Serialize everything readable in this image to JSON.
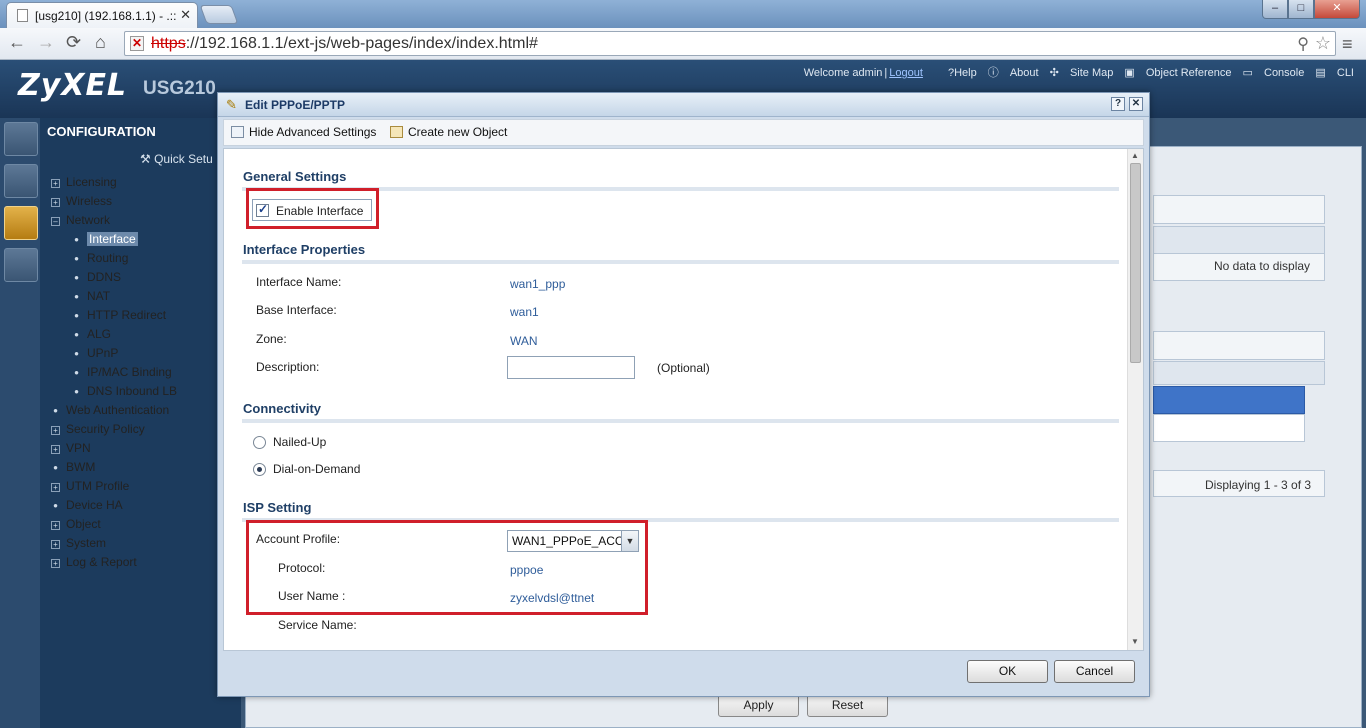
{
  "browser": {
    "tab_title": "[usg210] (192.168.1.1) - .::",
    "tab_close": "✕",
    "url_scheme": "https",
    "url_rest": "://192.168.1.1/ext-js/web-pages/index/index.html#",
    "window_controls": {
      "minimize": "–",
      "maximize": "□",
      "close": "✕"
    },
    "nav": {
      "back": "←",
      "forward": "→",
      "reload": "⟳",
      "home": "⌂"
    },
    "icons": {
      "zoom": "magnifier-icon",
      "star": "bookmark-star-icon",
      "menu": "wrench-menu-icon"
    }
  },
  "app": {
    "logo": "ZyXEL",
    "model": "USG210",
    "toplinks": {
      "welcome": "Welcome admin",
      "separator": "|",
      "logout": "Logout",
      "help": "?Help",
      "about": "About",
      "sitemap": "Site Map",
      "objref": "Object Reference",
      "console": "Console",
      "cli": "CLI"
    }
  },
  "sidebar": {
    "heading": "CONFIGURATION",
    "quick_setup": "Quick Setu",
    "items": [
      {
        "marker": "+",
        "label": "Licensing"
      },
      {
        "marker": "+",
        "label": "Wireless"
      },
      {
        "marker": "–",
        "label": "Network"
      },
      {
        "marker": "•",
        "label": "Interface"
      },
      {
        "marker": "•",
        "label": "Routing"
      },
      {
        "marker": "•",
        "label": "DDNS"
      },
      {
        "marker": "•",
        "label": "NAT"
      },
      {
        "marker": "•",
        "label": "HTTP Redirect"
      },
      {
        "marker": "•",
        "label": "ALG"
      },
      {
        "marker": "•",
        "label": "UPnP"
      },
      {
        "marker": "•",
        "label": "IP/MAC Binding"
      },
      {
        "marker": "•",
        "label": "DNS Inbound LB"
      },
      {
        "marker": "•",
        "label": "Web Authentication"
      },
      {
        "marker": "+",
        "label": "Security Policy"
      },
      {
        "marker": "+",
        "label": "VPN"
      },
      {
        "marker": "•",
        "label": "BWM"
      },
      {
        "marker": "+",
        "label": "UTM Profile"
      },
      {
        "marker": "•",
        "label": "Device HA"
      },
      {
        "marker": "+",
        "label": "Object"
      },
      {
        "marker": "+",
        "label": "System"
      },
      {
        "marker": "+",
        "label": "Log & Report"
      }
    ]
  },
  "background": {
    "no_data": "No data to display",
    "displaying": "Displaying 1 - 3 of 3",
    "apply": "Apply",
    "reset": "Reset"
  },
  "dialog": {
    "title": "Edit PPPoE/PPTP",
    "help_btn": "?",
    "close_btn": "✕",
    "toolbar": {
      "hide_advanced": "Hide Advanced Settings",
      "create_object": "Create new Object"
    },
    "general": {
      "heading": "General Settings",
      "enable_interface": "Enable Interface",
      "enable_checked": true
    },
    "interface_properties": {
      "heading": "Interface Properties",
      "name_label": "Interface Name:",
      "name_value": "wan1_ppp",
      "base_label": "Base Interface:",
      "base_value": "wan1",
      "zone_label": "Zone:",
      "zone_value": "WAN",
      "desc_label": "Description:",
      "desc_value": "",
      "desc_hint": "(Optional)"
    },
    "connectivity": {
      "heading": "Connectivity",
      "nailed_up": "Nailed-Up",
      "dial_on_demand": "Dial-on-Demand",
      "selected": "Dial-on-Demand"
    },
    "isp": {
      "heading": "ISP Setting",
      "account_label": "Account Profile:",
      "account_value": "WAN1_PPPoE_ACC",
      "protocol_label": "Protocol:",
      "protocol_value": "pppoe",
      "username_label": "User Name :",
      "username_value": "zyxelvdsl@ttnet",
      "service_label": "Service Name:"
    },
    "ok": "OK",
    "cancel": "Cancel"
  },
  "colors": {
    "highlight_red": "#d01f2a",
    "header_blue": "#1c3b5d",
    "value_blue": "#2f5d9a"
  }
}
